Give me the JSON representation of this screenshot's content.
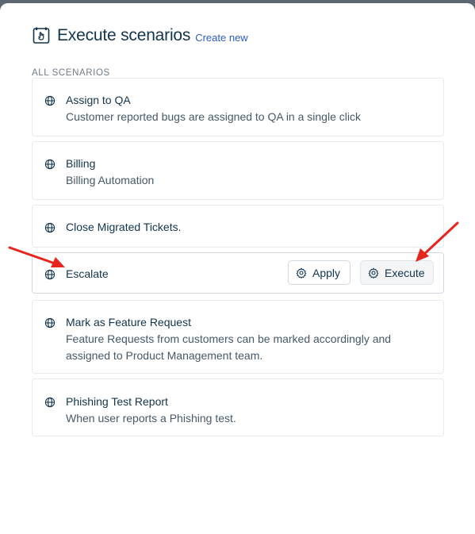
{
  "header": {
    "title": "Execute scenarios",
    "create_link": "Create new"
  },
  "section_label": "ALL SCENARIOS",
  "scenarios": [
    {
      "name": "Assign to QA",
      "description": "Customer reported bugs are assigned to QA in a single click"
    },
    {
      "name": "Billing",
      "description": "Billing Automation"
    },
    {
      "name": "Close Migrated Tickets.",
      "description": ""
    },
    {
      "name": "Escalate",
      "description": ""
    },
    {
      "name": "Mark as Feature Request",
      "description": "Feature Requests from customers can be marked accordingly and assigned to Product Management team."
    },
    {
      "name": "Phishing Test Report",
      "description": "When user reports a Phishing test."
    }
  ],
  "actions": {
    "apply_label": "Apply",
    "execute_label": "Execute"
  },
  "colors": {
    "annotation_arrow": "#e8251c",
    "link": "#2c5cc5",
    "text_primary": "#12344d"
  },
  "icons": [
    "scenario-execute-icon",
    "globe-icon",
    "gear-icon"
  ]
}
